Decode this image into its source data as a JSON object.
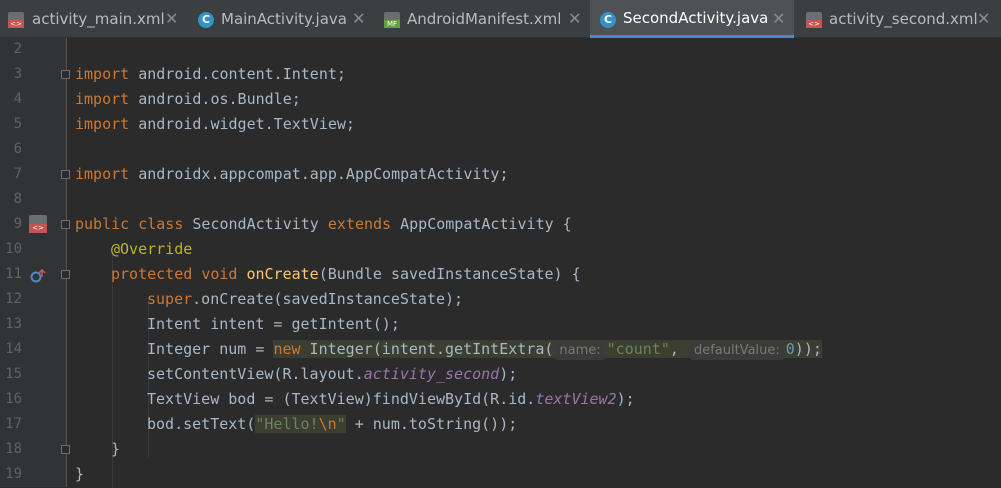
{
  "tabs": [
    {
      "label": "activity_main.xml",
      "icon": "xml-layout-file-icon",
      "active": false
    },
    {
      "label": "MainActivity.java",
      "icon": "java-class-icon",
      "active": false
    },
    {
      "label": "AndroidManifest.xml",
      "icon": "manifest-file-icon",
      "active": false
    },
    {
      "label": "SecondActivity.java",
      "icon": "java-class-icon",
      "active": true
    },
    {
      "label": "activity_second.xml",
      "icon": "xml-layout-file-icon",
      "active": false
    }
  ],
  "close_glyph": "✕",
  "line_numbers": [
    "2",
    "3",
    "4",
    "5",
    "6",
    "7",
    "8",
    "9",
    "10",
    "11",
    "12",
    "13",
    "14",
    "15",
    "16",
    "17",
    "18",
    "19"
  ],
  "code": {
    "l3_kw": "import",
    "l3_rest": " android.content.Intent;",
    "l4_kw": "import",
    "l4_rest": " android.os.Bundle;",
    "l5_kw": "import",
    "l5_rest": " android.widget.TextView;",
    "l7_kw": "import",
    "l7_rest": " androidx.appcompat.app.AppCompatActivity;",
    "l9_public": "public",
    "l9_class": "class",
    "l9_name": " SecondActivity ",
    "l9_extends": "extends",
    "l9_rest": " AppCompatActivity {",
    "l10_ann": "@Override",
    "l11_protected": "protected",
    "l11_void": "void",
    "l11_fn": "onCreate",
    "l11_rest": "(Bundle savedInstanceState) {",
    "l12_super": "super",
    "l12_rest": ".onCreate(savedInstanceState);",
    "l13": "Intent intent = getIntent();",
    "l14_pre": "Integer num = ",
    "l14_new": "new",
    "l14_mid": " Integer(intent.getIntExtra(",
    "l14_hint1": "name:",
    "l14_str": "\"count\"",
    "l14_comma": ",",
    "l14_hint2": "defaultValue:",
    "l14_num": "0",
    "l14_end": "));",
    "l15_pre": "setContentView(R.layout.",
    "l15_fld": "activity_second",
    "l15_end": ");",
    "l16_pre": "TextView bod = (TextView)findViewById(R.id.",
    "l16_fld": "textView2",
    "l16_end": ");",
    "l17_pre": "bod.setText(",
    "l17_str1": "\"Hello!",
    "l17_esc": "\\n",
    "l17_str2": "\"",
    "l17_mid": " + num.toString()",
    "l17_end": ");",
    "l18": "}",
    "l19": "}"
  }
}
